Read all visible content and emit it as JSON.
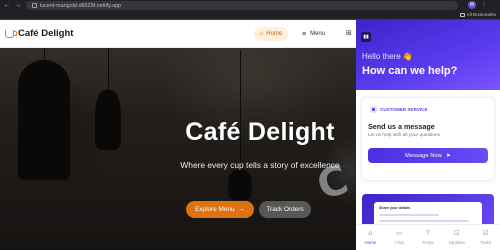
{
  "browser": {
    "url": "lucent-marigold-d8529f.netlify.app",
    "bookmarks_label": "All Bookmarks",
    "avatar_letter": "M"
  },
  "site": {
    "brand": "Café Delight",
    "nav": {
      "home": "Home",
      "menu": "Menu"
    },
    "hero": {
      "title": "Café Delight",
      "subtitle": "Where every cup tells a story of excellence",
      "primary_cta": "Explore Menu",
      "secondary_cta": "Track Orders"
    },
    "accent_color": "#dd7310"
  },
  "widget": {
    "greeting": "Hello there 👋",
    "headline": "How can we help?",
    "service_tag": "CUSTOMER SERVICE",
    "card_title": "Send us a message",
    "card_subtitle": "Let us help with all your questions",
    "message_button": "Message Now",
    "promo_title": "Share your details",
    "tabs": [
      {
        "label": "Home",
        "icon": "home-icon",
        "active": true
      },
      {
        "label": "Chat",
        "icon": "chat-icon",
        "active": false
      },
      {
        "label": "FAQs",
        "icon": "faq-icon",
        "active": false
      },
      {
        "label": "Updates",
        "icon": "updates-icon",
        "active": false
      },
      {
        "label": "Tasks",
        "icon": "tasks-icon",
        "active": false
      }
    ],
    "brand_color": "#4b2fe0"
  }
}
